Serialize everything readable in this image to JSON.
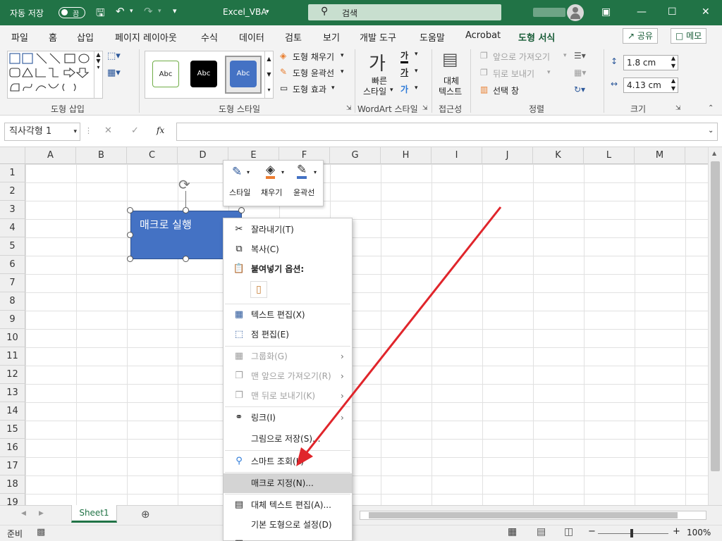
{
  "titlebar": {
    "autosave_label": "자동 저장",
    "autosave_state": "끔",
    "filename": "Excel_VBA",
    "search_placeholder": "검색"
  },
  "tabs": [
    "파일",
    "홈",
    "삽입",
    "페이지 레이아웃",
    "수식",
    "데이터",
    "검토",
    "보기",
    "개발 도구",
    "도움말",
    "Acrobat",
    "도형 서식"
  ],
  "active_tab": "도형 서식",
  "share_label": "공유",
  "comment_label": "메모",
  "ribbon": {
    "insert_shapes_label": "도형 삽입",
    "shape_styles_label": "도형 스타일",
    "style_samples": [
      "Abc",
      "Abc",
      "Abc"
    ],
    "fill_label": "도형 채우기",
    "outline_label": "도형 윤곽선",
    "effects_label": "도형 효과",
    "wordart_label": "WordArt 스타일",
    "quick_styles_label": "빠른\n스타일",
    "quick_styles_line1": "빠른",
    "quick_styles_line2": "스타일",
    "accessibility_label": "접근성",
    "alt_text_line1": "대체",
    "alt_text_line2": "텍스트",
    "arrange_label": "정렬",
    "bring_forward": "앞으로 가져오기",
    "send_backward": "뒤로 보내기",
    "selection_pane": "선택 창",
    "size_label": "크기",
    "height_value": "1.8 cm",
    "width_value": "4.13 cm"
  },
  "formula": {
    "name_box": "직사각형 1",
    "fx_symbol": "fx"
  },
  "columns": [
    "A",
    "B",
    "C",
    "D",
    "E",
    "F",
    "G",
    "H",
    "I",
    "J",
    "K",
    "L",
    "M"
  ],
  "rows": [
    "1",
    "2",
    "3",
    "4",
    "5",
    "6",
    "7",
    "8",
    "9",
    "10",
    "11",
    "12",
    "13",
    "14",
    "15",
    "16",
    "17",
    "18",
    "19"
  ],
  "shape": {
    "text": "매크로 실행",
    "fill_color": "#4472c4"
  },
  "minibar": {
    "style": "스타일",
    "fill": "채우기",
    "outline": "윤곽선"
  },
  "context_menu": {
    "cut": "잘라내기(T)",
    "copy": "복사(C)",
    "paste_options": "붙여넣기 옵션:",
    "edit_text": "텍스트 편집(X)",
    "edit_points": "점 편집(E)",
    "group": "그룹화(G)",
    "bring_to_front": "맨 앞으로 가져오기(R)",
    "send_to_back": "맨 뒤로 보내기(K)",
    "link": "링크(I)",
    "save_as_picture": "그림으로 저장(S)...",
    "smart_lookup": "스마트 조회(L)",
    "assign_macro": "매크로 지정(N)...",
    "edit_alt_text": "대체 텍스트 편집(A)...",
    "set_default_shape": "기본 도형으로 설정(D)"
  },
  "sheet_tab": "Sheet1",
  "status": {
    "ready": "준비",
    "zoom": "100%"
  },
  "colors": {
    "excel_green": "#217346",
    "arrow_red": "#e0252b"
  }
}
